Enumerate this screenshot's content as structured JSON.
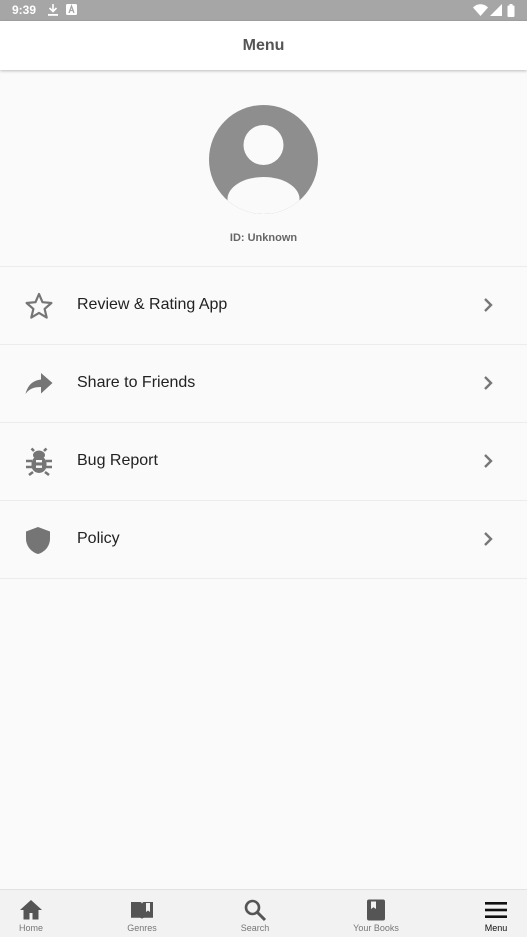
{
  "status_bar": {
    "time": "9:39",
    "icons": [
      "download-icon",
      "a-badge-icon",
      "wifi-icon",
      "signal-icon",
      "battery-icon"
    ]
  },
  "header": {
    "title": "Menu"
  },
  "profile": {
    "id_text": "ID: Unknown",
    "avatar_icon": "account-circle-icon"
  },
  "menu": {
    "items": [
      {
        "label": "Review & Rating App",
        "icon": "star-outline-icon"
      },
      {
        "label": "Share to Friends",
        "icon": "share-arrow-icon"
      },
      {
        "label": "Bug Report",
        "icon": "bug-icon"
      },
      {
        "label": "Policy",
        "icon": "shield-icon"
      }
    ]
  },
  "bottom_nav": {
    "items": [
      {
        "label": "Home",
        "icon": "home-icon"
      },
      {
        "label": "Genres",
        "icon": "open-book-icon"
      },
      {
        "label": "Search",
        "icon": "search-icon"
      },
      {
        "label": "Your Books",
        "icon": "bookmark-book-icon"
      },
      {
        "label": "Menu",
        "icon": "hamburger-menu-icon"
      }
    ],
    "active": "Menu"
  },
  "colors": {
    "status_bar": "#a6a6a6",
    "icon_gray": "#757575",
    "text": "#222222",
    "background": "#fafafa"
  }
}
